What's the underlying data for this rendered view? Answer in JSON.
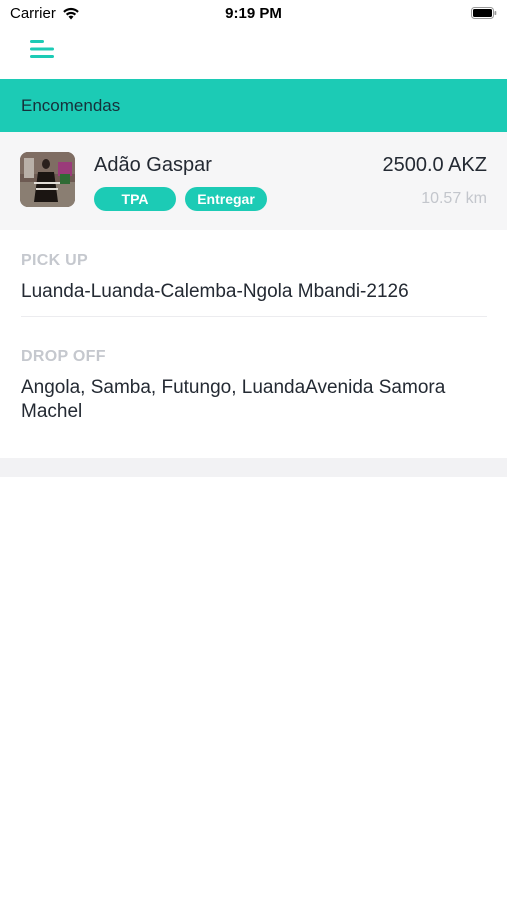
{
  "status_bar": {
    "carrier": "Carrier",
    "time": "9:19 PM"
  },
  "nav": {
    "menu_icon": "hamburger-menu-icon"
  },
  "section": {
    "title": "Encomendas"
  },
  "order": {
    "customer_name": "Adão Gaspar",
    "price": "2500.0 AKZ",
    "distance": "10.57 km",
    "payment_badge": "TPA",
    "status_badge": "Entregar"
  },
  "pickup": {
    "label": "PICK UP",
    "address": "Luanda-Luanda-Calemba-Ngola Mbandi-2126"
  },
  "dropoff": {
    "label": "DROP OFF",
    "address": "Angola, Samba, Futungo, LuandaAvenida Samora Machel"
  },
  "colors": {
    "accent": "#1ccbb5",
    "card_background": "#f6f6f7",
    "muted_text": "#c5c8ce"
  }
}
